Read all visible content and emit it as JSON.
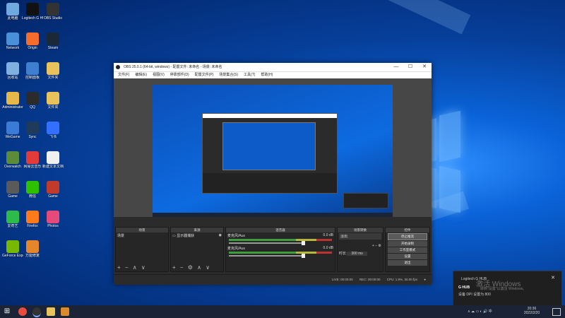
{
  "desktop": {
    "icons": [
      {
        "label": "此电脑",
        "color": "#6fa9e0"
      },
      {
        "label": "Logitech G HUB",
        "color": "#111"
      },
      {
        "label": "OBS Studio",
        "color": "#333"
      },
      {
        "label": "Network",
        "color": "#4a90d9"
      },
      {
        "label": "Origin",
        "color": "#f56c2d"
      },
      {
        "label": "Steam",
        "color": "#1b2838"
      },
      {
        "label": "回收站",
        "color": "#7fb0e0"
      },
      {
        "label": "控制面板",
        "color": "#3f7fd0"
      },
      {
        "label": "文件夹",
        "color": "#e8c25a"
      },
      {
        "label": "Administrator",
        "color": "#e6b84a"
      },
      {
        "label": "QQ",
        "color": "#2b2b2b"
      },
      {
        "label": "文件夹",
        "color": "#e8c25a"
      },
      {
        "label": "WeGame",
        "color": "#3a7bd5"
      },
      {
        "label": "Sync",
        "color": "#1f3a5a"
      },
      {
        "label": "飞书",
        "color": "#3370ff"
      },
      {
        "label": "Overwatch",
        "color": "#5a8c3a"
      },
      {
        "label": "网易云音乐",
        "color": "#e33a3a"
      },
      {
        "label": "新建文本文档",
        "color": "#f0f0f0"
      },
      {
        "label": "Game",
        "color": "#5a5a5a"
      },
      {
        "label": "微信",
        "color": "#2dc100"
      },
      {
        "label": "Game",
        "color": "#c23a2a"
      },
      {
        "label": "爱奇艺",
        "color": "#2dbb4a"
      },
      {
        "label": "Firefox",
        "color": "#ff7a1a"
      },
      {
        "label": "Photos",
        "color": "#e64a7a"
      },
      {
        "label": "GeForce Experience",
        "color": "#76b900"
      },
      {
        "label": "万能修复",
        "color": "#e6862a"
      }
    ]
  },
  "obs": {
    "title": "OBS 25.0.1 (64-bit, windows) - 配置文件: 未命名 - 场景: 未命名",
    "menu": [
      "文件(F)",
      "编辑(E)",
      "视图(V)",
      "停靠部件(D)",
      "配置文件(P)",
      "场景集合(S)",
      "工具(T)",
      "帮助(H)"
    ],
    "docks": {
      "scenes": {
        "title": "场景",
        "items": [
          "场景"
        ]
      },
      "sources": {
        "title": "来源",
        "items": [
          "显示器捕获"
        ]
      },
      "mixer": {
        "title": "混音器",
        "channels": [
          {
            "name": "麦克风/Aux",
            "level": "0.0 dB"
          },
          {
            "name": "麦克风/Aux",
            "level": "0.0 dB"
          }
        ]
      },
      "transitions": {
        "title": "场景转换",
        "mode": "淡出",
        "duration_label": "时长",
        "duration_value": "300 ms"
      },
      "controls": {
        "title": "控件",
        "buttons": [
          "停止推流",
          "开始录制",
          "工作室模式",
          "设置",
          "退出"
        ]
      }
    },
    "status": {
      "live": "LIVE: 00:00:00",
      "rec": "REC: 00:00:00",
      "cpu": "CPU: 1.9%, 30.00 fps"
    }
  },
  "notification": {
    "app": "Logitech G HUB",
    "title": "G HUB",
    "body": "设备 DPI 设置为 800",
    "watermark": "激活 Windows",
    "watermark_sub": "转到\"设置\"以激活 Windows。"
  },
  "taskbar": {
    "time": "20:36",
    "date": "2022/2/20",
    "lang": "中"
  },
  "colors": {
    "accent": "#0a63d8",
    "obs_bg": "#2b2b2b"
  }
}
